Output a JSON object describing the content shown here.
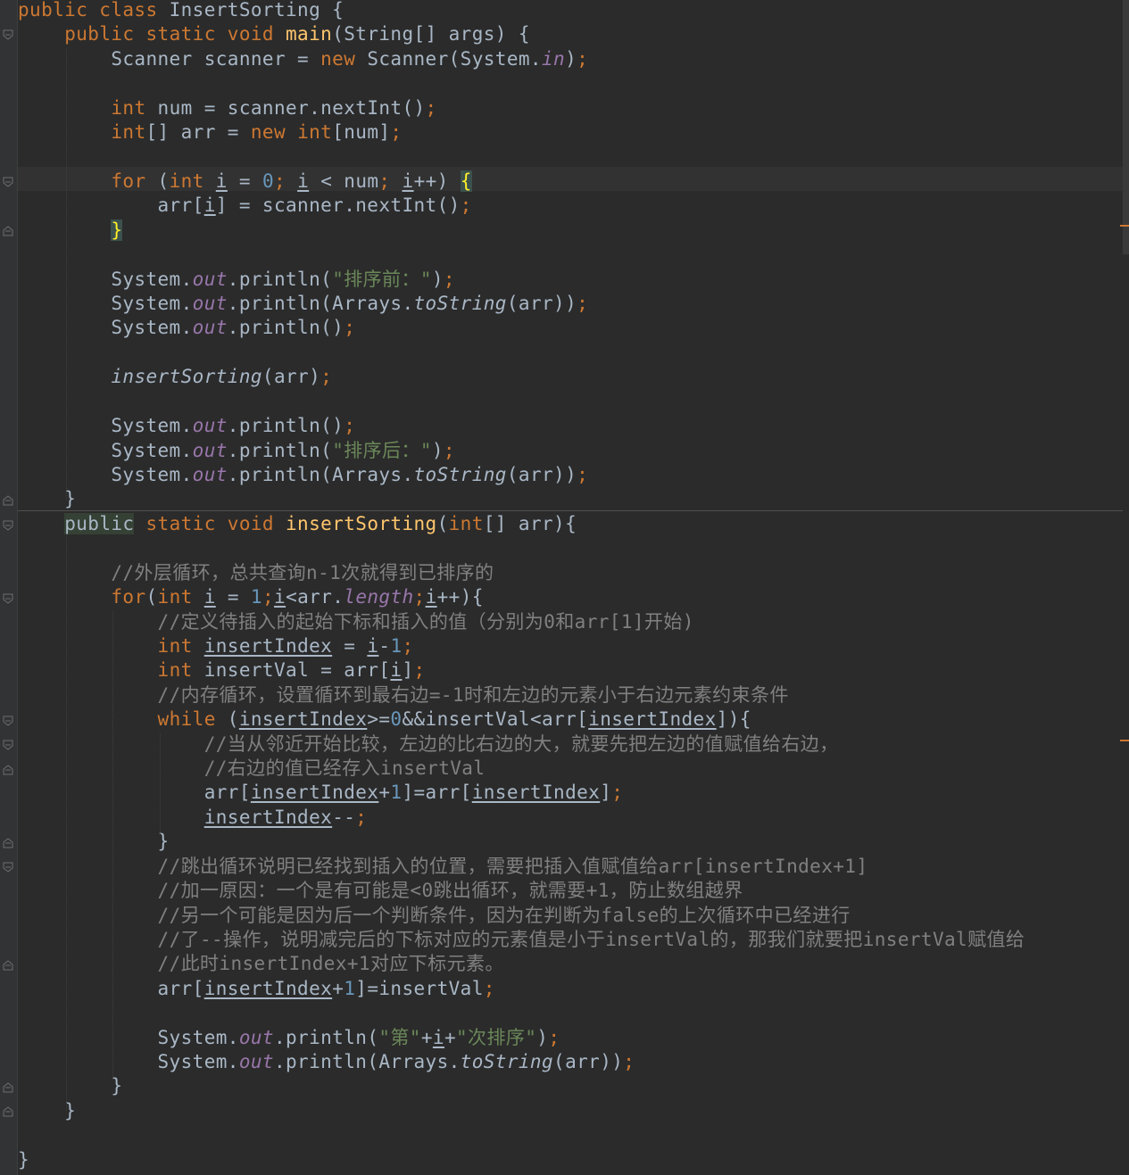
{
  "editor": {
    "language": "java",
    "file_class": "InsertSorting",
    "colors": {
      "background": "#2b2b2b",
      "keyword": "#cc7832",
      "text": "#a9b7c6",
      "method": "#ffc66d",
      "number": "#6897bb",
      "string": "#6a8759",
      "field": "#9876aa",
      "comment": "#808080"
    },
    "lines": [
      [
        [
          "kw",
          "public class "
        ],
        [
          "plain",
          "InsertSorting {"
        ]
      ],
      [
        [
          "plain",
          "    "
        ],
        [
          "kw",
          "public static void "
        ],
        [
          "fn",
          "main"
        ],
        [
          "plain",
          "(String[] args) {"
        ]
      ],
      [
        [
          "plain",
          "        Scanner scanner = "
        ],
        [
          "kw",
          "new "
        ],
        [
          "plain",
          "Scanner(System."
        ],
        [
          "field",
          "in"
        ],
        [
          "plain",
          ")"
        ],
        [
          "kw",
          ";"
        ]
      ],
      [],
      [
        [
          "plain",
          "        "
        ],
        [
          "kw",
          "int "
        ],
        [
          "plain",
          "num = scanner.nextInt()"
        ],
        [
          "kw",
          ";"
        ]
      ],
      [
        [
          "plain",
          "        "
        ],
        [
          "kw",
          "int"
        ],
        [
          "plain",
          "[] arr = "
        ],
        [
          "kw",
          "new int"
        ],
        [
          "plain",
          "[num]"
        ],
        [
          "kw",
          ";"
        ]
      ],
      [],
      [
        [
          "plain",
          "        "
        ],
        [
          "kw",
          "for "
        ],
        [
          "plain",
          "("
        ],
        [
          "kw",
          "int "
        ],
        [
          "var",
          "i"
        ],
        [
          "plain",
          " = "
        ],
        [
          "num",
          "0"
        ],
        [
          "kw",
          "; "
        ],
        [
          "var",
          "i"
        ],
        [
          "plain",
          " < num"
        ],
        [
          "kw",
          "; "
        ],
        [
          "var",
          "i"
        ],
        [
          "plain",
          "++) "
        ],
        [
          "brace",
          "{"
        ]
      ],
      [
        [
          "plain",
          "            arr["
        ],
        [
          "var",
          "i"
        ],
        [
          "plain",
          "] = scanner.nextInt()"
        ],
        [
          "kw",
          ";"
        ]
      ],
      [
        [
          "plain",
          "        "
        ],
        [
          "brace",
          "}"
        ]
      ],
      [],
      [
        [
          "plain",
          "        System."
        ],
        [
          "field",
          "out"
        ],
        [
          "plain",
          ".println("
        ],
        [
          "str",
          "\"排序前：\""
        ],
        [
          "plain",
          ")"
        ],
        [
          "kw",
          ";"
        ]
      ],
      [
        [
          "plain",
          "        System."
        ],
        [
          "field",
          "out"
        ],
        [
          "plain",
          ".println(Arrays."
        ],
        [
          "static",
          "toString"
        ],
        [
          "plain",
          "(arr))"
        ],
        [
          "kw",
          ";"
        ]
      ],
      [
        [
          "plain",
          "        System."
        ],
        [
          "field",
          "out"
        ],
        [
          "plain",
          ".println()"
        ],
        [
          "kw",
          ";"
        ]
      ],
      [],
      [
        [
          "plain",
          "        "
        ],
        [
          "static",
          "insertSorting"
        ],
        [
          "plain",
          "(arr)"
        ],
        [
          "kw",
          ";"
        ]
      ],
      [],
      [
        [
          "plain",
          "        System."
        ],
        [
          "field",
          "out"
        ],
        [
          "plain",
          ".println()"
        ],
        [
          "kw",
          ";"
        ]
      ],
      [
        [
          "plain",
          "        System."
        ],
        [
          "field",
          "out"
        ],
        [
          "plain",
          ".println("
        ],
        [
          "str",
          "\"排序后：\""
        ],
        [
          "plain",
          ")"
        ],
        [
          "kw",
          ";"
        ]
      ],
      [
        [
          "plain",
          "        System."
        ],
        [
          "field",
          "out"
        ],
        [
          "plain",
          ".println(Arrays."
        ],
        [
          "static",
          "toString"
        ],
        [
          "plain",
          "(arr))"
        ],
        [
          "kw",
          ";"
        ]
      ],
      [
        [
          "plain",
          "    }"
        ]
      ],
      [
        [
          "plain",
          "    "
        ],
        [
          "hl",
          "public"
        ],
        [
          "kw",
          " static void "
        ],
        [
          "fn",
          "insertSorting"
        ],
        [
          "plain",
          "("
        ],
        [
          "kw",
          "int"
        ],
        [
          "plain",
          "[] arr){"
        ]
      ],
      [],
      [
        [
          "plain",
          "        "
        ],
        [
          "comment",
          "//外层循环，总共查询n-1次就得到已排序的"
        ]
      ],
      [
        [
          "plain",
          "        "
        ],
        [
          "kw",
          "for"
        ],
        [
          "plain",
          "("
        ],
        [
          "kw",
          "int "
        ],
        [
          "var",
          "i"
        ],
        [
          "plain",
          " = "
        ],
        [
          "num",
          "1"
        ],
        [
          "kw",
          ";"
        ],
        [
          "var",
          "i"
        ],
        [
          "plain",
          "<arr."
        ],
        [
          "field",
          "length"
        ],
        [
          "kw",
          ";"
        ],
        [
          "var",
          "i"
        ],
        [
          "plain",
          "++){"
        ]
      ],
      [
        [
          "plain",
          "            "
        ],
        [
          "comment",
          "//定义待插入的起始下标和插入的值（分别为0和arr[1]开始)"
        ]
      ],
      [
        [
          "plain",
          "            "
        ],
        [
          "kw",
          "int "
        ],
        [
          "var",
          "insertIndex"
        ],
        [
          "plain",
          " = "
        ],
        [
          "var",
          "i"
        ],
        [
          "plain",
          "-"
        ],
        [
          "num",
          "1"
        ],
        [
          "kw",
          ";"
        ]
      ],
      [
        [
          "plain",
          "            "
        ],
        [
          "kw",
          "int "
        ],
        [
          "plain",
          "insertVal = arr["
        ],
        [
          "var",
          "i"
        ],
        [
          "plain",
          "]"
        ],
        [
          "kw",
          ";"
        ]
      ],
      [
        [
          "plain",
          "            "
        ],
        [
          "comment",
          "//内存循环，设置循环到最右边=-1时和左边的元素小于右边元素约束条件"
        ]
      ],
      [
        [
          "plain",
          "            "
        ],
        [
          "kw",
          "while "
        ],
        [
          "plain",
          "("
        ],
        [
          "var",
          "insertIndex"
        ],
        [
          "plain",
          ">="
        ],
        [
          "num",
          "0"
        ],
        [
          "plain",
          "&&insertVal<arr["
        ],
        [
          "var",
          "insertIndex"
        ],
        [
          "plain",
          "]){"
        ]
      ],
      [
        [
          "plain",
          "                "
        ],
        [
          "comment",
          "//当从邻近开始比较，左边的比右边的大，就要先把左边的值赋值给右边，"
        ]
      ],
      [
        [
          "plain",
          "                "
        ],
        [
          "comment",
          "//右边的值已经存入insertVal"
        ]
      ],
      [
        [
          "plain",
          "                arr["
        ],
        [
          "var",
          "insertIndex"
        ],
        [
          "plain",
          "+"
        ],
        [
          "num",
          "1"
        ],
        [
          "plain",
          "]=arr["
        ],
        [
          "var",
          "insertIndex"
        ],
        [
          "plain",
          "]"
        ],
        [
          "kw",
          ";"
        ]
      ],
      [
        [
          "plain",
          "                "
        ],
        [
          "var",
          "insertIndex"
        ],
        [
          "plain",
          "--"
        ],
        [
          "kw",
          ";"
        ]
      ],
      [
        [
          "plain",
          "            }"
        ]
      ],
      [
        [
          "plain",
          "            "
        ],
        [
          "comment",
          "//跳出循环说明已经找到插入的位置，需要把插入值赋值给arr[insertIndex+1]"
        ]
      ],
      [
        [
          "plain",
          "            "
        ],
        [
          "comment",
          "//加一原因：一个是有可能是<0跳出循环，就需要+1，防止数组越界"
        ]
      ],
      [
        [
          "plain",
          "            "
        ],
        [
          "comment",
          "//另一个可能是因为后一个判断条件，因为在判断为false的上次循环中已经进行"
        ]
      ],
      [
        [
          "plain",
          "            "
        ],
        [
          "comment",
          "//了--操作，说明减完后的下标对应的元素值是小于insertVal的，那我们就要把insertVal赋值给"
        ]
      ],
      [
        [
          "plain",
          "            "
        ],
        [
          "comment",
          "//此时insertIndex+1对应下标元素。"
        ]
      ],
      [
        [
          "plain",
          "            arr["
        ],
        [
          "var",
          "insertIndex"
        ],
        [
          "plain",
          "+"
        ],
        [
          "num",
          "1"
        ],
        [
          "plain",
          "]=insertVal"
        ],
        [
          "kw",
          ";"
        ]
      ],
      [],
      [
        [
          "plain",
          "            System."
        ],
        [
          "field",
          "out"
        ],
        [
          "plain",
          ".println("
        ],
        [
          "str",
          "\"第\""
        ],
        [
          "plain",
          "+"
        ],
        [
          "var",
          "i"
        ],
        [
          "plain",
          "+"
        ],
        [
          "str",
          "\"次排序\""
        ],
        [
          "plain",
          ")"
        ],
        [
          "kw",
          ";"
        ]
      ],
      [
        [
          "plain",
          "            System."
        ],
        [
          "field",
          "out"
        ],
        [
          "plain",
          ".println(Arrays."
        ],
        [
          "static",
          "toString"
        ],
        [
          "plain",
          "(arr))"
        ],
        [
          "kw",
          ";"
        ]
      ],
      [
        [
          "plain",
          "        }"
        ]
      ],
      [
        [
          "plain",
          "    }"
        ]
      ],
      [],
      [
        [
          "plain",
          "}"
        ]
      ]
    ]
  }
}
